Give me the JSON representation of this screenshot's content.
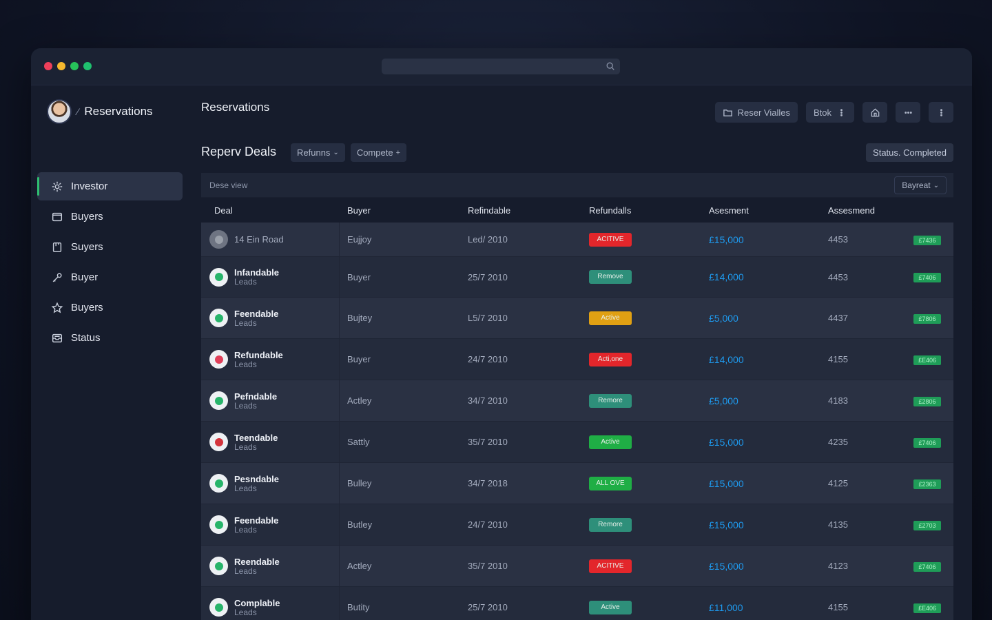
{
  "colors": {
    "dot_red": "#ee3f5a",
    "dot_yellow": "#f5b82e",
    "dot_green1": "#27c25a",
    "dot_green2": "#1fbf6e",
    "accent_green": "#2fbf71",
    "amount_blue": "#1e9bf0"
  },
  "brand": {
    "separator": "⁄",
    "title": "Reservations"
  },
  "sidebar": {
    "items": [
      {
        "label": "Investor",
        "icon": "gear-icon",
        "active": true
      },
      {
        "label": "Buyers",
        "icon": "folder-icon"
      },
      {
        "label": "Suyers",
        "icon": "document-icon"
      },
      {
        "label": "Buyer",
        "icon": "key-icon"
      },
      {
        "label": "Buyers",
        "icon": "star-icon"
      },
      {
        "label": "Status",
        "icon": "inbox-icon"
      }
    ]
  },
  "header": {
    "title": "Reservations",
    "toolbar": {
      "reset_label": "Reser Vialles",
      "block_label": "Btok"
    }
  },
  "section": {
    "title": "Reperv Deals",
    "filter1": "Refunns",
    "filter2": "Compete",
    "status": "Status. Completed"
  },
  "table": {
    "description": "Dese view",
    "sort_label": "Bayreat",
    "columns": [
      "Deal",
      "Buyer",
      "Refindable",
      "Refundalls",
      "Asesment",
      "Assesmend"
    ],
    "rows": [
      {
        "title": "14 Ein Road",
        "sub": "",
        "icon_color": "#9aa0aa",
        "icon_bg": "#6e7482",
        "buyer": "Eujjoy",
        "date": "Led/ 2010",
        "status": "ACITIVE",
        "status_color": "#e3262b",
        "amount": "£15,000",
        "num": "4453",
        "tag": "£7436"
      },
      {
        "title": "Infandable",
        "sub": "Leads",
        "icon_color": "#27b46a",
        "icon_bg": "#eef1f4",
        "buyer": "Buyer",
        "date": "25/7 2010",
        "status": "Remove",
        "status_color": "#2e8f7a",
        "amount": "£14,000",
        "num": "4453",
        "tag": "£7406"
      },
      {
        "title": "Feendable",
        "sub": "Leads",
        "icon_color": "#27b46a",
        "icon_bg": "#eef1f4",
        "buyer": "Bujtey",
        "date": "L5/7 2010",
        "status": "Active",
        "status_color": "#e0a013",
        "amount": "£5,000",
        "num": "4437",
        "tag": "£7806"
      },
      {
        "title": "Refundable",
        "sub": "Leads",
        "icon_color": "#e0405a",
        "icon_bg": "#eef1f4",
        "buyer": "Buyer",
        "date": "24/7 2010",
        "status": "Acti,one",
        "status_color": "#e3262b",
        "amount": "£14,000",
        "num": "4155",
        "tag": "£E406"
      },
      {
        "title": "Pefndable",
        "sub": "Leads",
        "icon_color": "#27b46a",
        "icon_bg": "#eef1f4",
        "buyer": "Actley",
        "date": "34/7 2010",
        "status": "Remore",
        "status_color": "#2e8f7a",
        "amount": "£5,000",
        "num": "4183",
        "tag": "£2806"
      },
      {
        "title": "Teendable",
        "sub": "Leads",
        "icon_color": "#d4343c",
        "icon_bg": "#eef1f4",
        "buyer": "Sattly",
        "date": "35/7 2010",
        "status": "Active",
        "status_color": "#1fae45",
        "amount": "£15,000",
        "num": "4235",
        "tag": "£7406"
      },
      {
        "title": "Pesndable",
        "sub": "Leads",
        "icon_color": "#27b46a",
        "icon_bg": "#eef1f4",
        "buyer": "Bulley",
        "date": "34/7 2018",
        "status": "ALL OVE",
        "status_color": "#1fae45",
        "amount": "£15,000",
        "num": "4125",
        "tag": "£2363"
      },
      {
        "title": "Feendable",
        "sub": "Leads",
        "icon_color": "#27b46a",
        "icon_bg": "#eef1f4",
        "buyer": "Butley",
        "date": "24/7 2010",
        "status": "Remore",
        "status_color": "#2e8f7a",
        "amount": "£15,000",
        "num": "4135",
        "tag": "£2703"
      },
      {
        "title": "Reendable",
        "sub": "Leads",
        "icon_color": "#27b46a",
        "icon_bg": "#eef1f4",
        "buyer": "Actley",
        "date": "35/7 2010",
        "status": "ACITIVE",
        "status_color": "#e3262b",
        "amount": "£15,000",
        "num": "4123",
        "tag": "£7406"
      },
      {
        "title": "Complable",
        "sub": "Leads",
        "icon_color": "#27b46a",
        "icon_bg": "#eef1f4",
        "buyer": "Butity",
        "date": "25/7 2010",
        "status": "Active",
        "status_color": "#2e8f7a",
        "amount": "£11,000",
        "num": "4155",
        "tag": "£E406"
      }
    ]
  }
}
